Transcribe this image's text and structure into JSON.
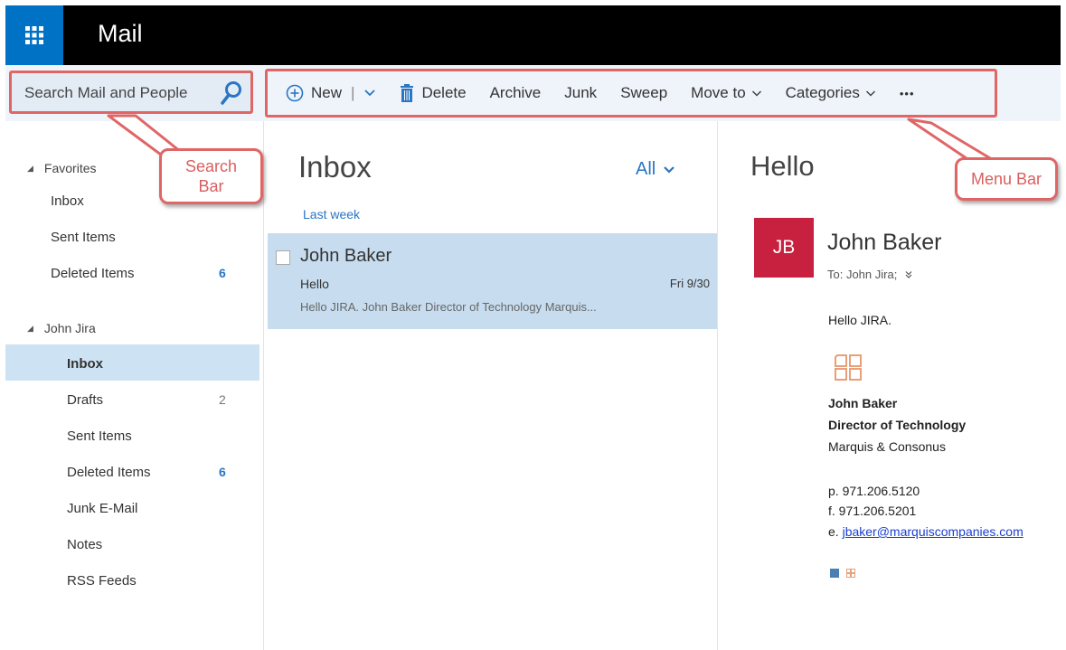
{
  "app": {
    "title": "Mail"
  },
  "search": {
    "placeholder": "Search Mail and People"
  },
  "menu": {
    "new": "New",
    "separator": "|",
    "delete": "Delete",
    "archive": "Archive",
    "junk": "Junk",
    "sweep": "Sweep",
    "move_to": "Move to",
    "categories": "Categories",
    "more": "•••"
  },
  "folders": {
    "favorites": {
      "label": "Favorites",
      "items": [
        {
          "label": "Inbox",
          "count": ""
        },
        {
          "label": "Sent Items",
          "count": ""
        },
        {
          "label": "Deleted Items",
          "count": "6"
        }
      ]
    },
    "account": {
      "label": "John Jira",
      "items": [
        {
          "label": "Inbox",
          "count": ""
        },
        {
          "label": "Drafts",
          "count": "2"
        },
        {
          "label": "Sent Items",
          "count": ""
        },
        {
          "label": "Deleted Items",
          "count": "6"
        },
        {
          "label": "Junk E-Mail",
          "count": ""
        },
        {
          "label": "Notes",
          "count": ""
        },
        {
          "label": "RSS Feeds",
          "count": ""
        }
      ]
    }
  },
  "list": {
    "title": "Inbox",
    "filter": "All",
    "group_label": "Last week",
    "messages": [
      {
        "sender": "John Baker",
        "subject": "Hello",
        "date": "Fri 9/30",
        "preview": "Hello JIRA. John Baker Director of Technology Marquis..."
      }
    ]
  },
  "reading": {
    "subject": "Hello",
    "avatar_initials": "JB",
    "sender": "John Baker",
    "to": "To: John Jira;",
    "greeting": "Hello JIRA.",
    "signature": {
      "name": "John Baker",
      "title": "Director of Technology",
      "company": "Marquis & Consonus",
      "phone": "p. 971.206.5120",
      "fax": "f.  971.206.5201",
      "email_prefix": "e. ",
      "email": "jbaker@marquiscompanies.com"
    }
  },
  "callouts": {
    "search_line1": "Search",
    "search_line2": "Bar",
    "menu": "Menu Bar"
  },
  "colors": {
    "brand_blue": "#0072c6",
    "accent_blue": "#2a75c4",
    "avatar_red": "#c8203f",
    "annotation_red": "#e06666",
    "selection": "#cde3f3"
  }
}
